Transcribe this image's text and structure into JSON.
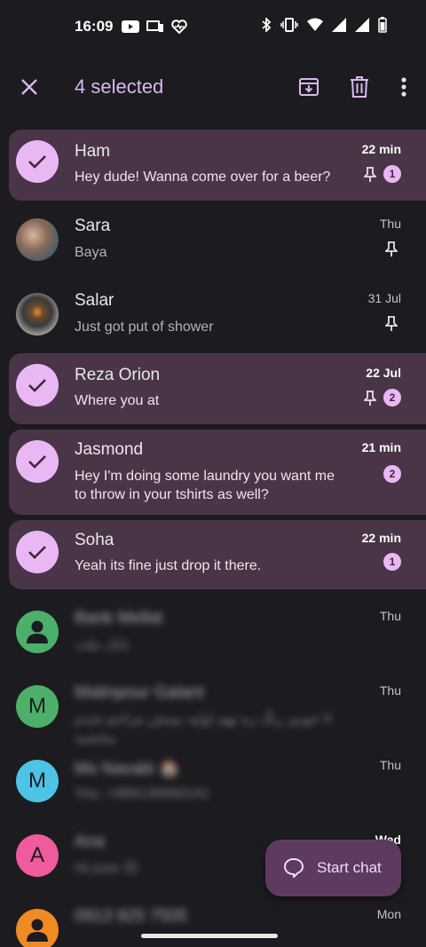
{
  "status_bar": {
    "time": "16:09"
  },
  "app_bar": {
    "title": "4 selected"
  },
  "conversations": [
    {
      "name": "Ham",
      "preview": "Hey dude! Wanna come over for a beer?",
      "time": "22 min",
      "selected": true,
      "pinned": true,
      "unread": "1"
    },
    {
      "name": "Sara",
      "preview": "Baya",
      "time": "Thu",
      "selected": false,
      "pinned": true
    },
    {
      "name": "Salar",
      "preview": "Just got put of shower",
      "time": "31 Jul",
      "selected": false,
      "pinned": true
    },
    {
      "name": "Reza Orion",
      "preview": "Where you at",
      "time": "22 Jul",
      "selected": true,
      "pinned": true,
      "unread": "2"
    },
    {
      "name": "Jasmond",
      "preview": "Hey I'm doing some laundry you want me to throw in your tshirts as well?",
      "time": "21 min",
      "selected": true,
      "unread": "2"
    },
    {
      "name": "Soha",
      "preview": "Yeah its fine just drop it there.",
      "time": "22 min",
      "selected": true,
      "unread": "1"
    },
    {
      "name": "Bank Mellat",
      "preview": "بانک ملت",
      "time": "Thu",
      "selected": false,
      "avatar_color": "#4caf6a"
    },
    {
      "name": "Matinpour Galant",
      "preview": "لا خونیز رنگ زه بهم اولیه بیمش مزاحم شدم ببخشید",
      "time": "Thu",
      "selected": false,
      "avatar_letter": "M",
      "avatar_color": "#4caf6a"
    },
    {
      "name": "Ms Navabi 🏠",
      "preview": "You: +989130000141",
      "time": "Thu",
      "selected": false,
      "avatar_letter": "M",
      "avatar_color": "#4dc3e6"
    },
    {
      "name": "Ana",
      "preview": "Hi,sure 😊",
      "time": "Wed",
      "selected": false,
      "avatar_letter": "A",
      "avatar_color": "#ef5b9c"
    },
    {
      "name": "0913 925 7505",
      "preview": "",
      "time": "Mon",
      "selected": false,
      "avatar_color": "#f08a24"
    }
  ],
  "fab": {
    "label": "Start chat"
  },
  "icons": [
    "close-icon",
    "archive-icon",
    "delete-icon",
    "more-vert-icon",
    "check-icon",
    "pin-icon",
    "person-icon",
    "chat-bubble-icon"
  ],
  "colors": {
    "background": "#1c1b1f",
    "selected_row": "#4a3548",
    "accent": "#e9b8f4",
    "fab": "#5d3b5e"
  }
}
